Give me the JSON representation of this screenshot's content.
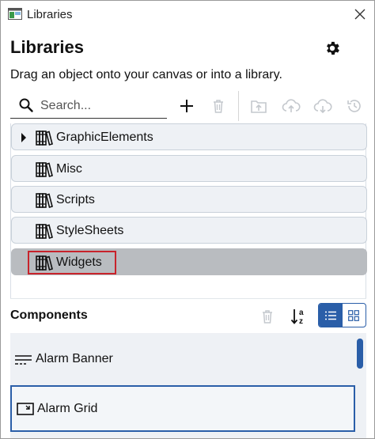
{
  "window": {
    "title": "Libraries"
  },
  "header": {
    "title": "Libraries",
    "subtitle": "Drag an object onto your canvas or into a library."
  },
  "search": {
    "placeholder": "Search...",
    "value": ""
  },
  "toolbar": {
    "icons": [
      "add-icon",
      "delete-icon",
      "upload-folder-icon",
      "cloud-upload-icon",
      "cloud-download-icon",
      "history-icon"
    ]
  },
  "libraries": {
    "items": [
      {
        "label": "GraphicElements",
        "expandable": true,
        "selected": false
      },
      {
        "label": "Misc",
        "expandable": false,
        "selected": false
      },
      {
        "label": "Scripts",
        "expandable": false,
        "selected": false
      },
      {
        "label": "StyleSheets",
        "expandable": false,
        "selected": false
      },
      {
        "label": "Widgets",
        "expandable": false,
        "selected": true
      }
    ]
  },
  "components": {
    "title": "Components",
    "view_mode": "list",
    "items": [
      {
        "label": "Alarm Banner",
        "icon": "alarm-banner-icon",
        "selected": false
      },
      {
        "label": "Alarm Grid",
        "icon": "alarm-grid-icon",
        "selected": true
      }
    ]
  },
  "colors": {
    "accent": "#2a5ea8",
    "highlight_outline": "#c8232b",
    "item_bg": "#eef1f5",
    "selected_bg": "#b9bcc0"
  }
}
